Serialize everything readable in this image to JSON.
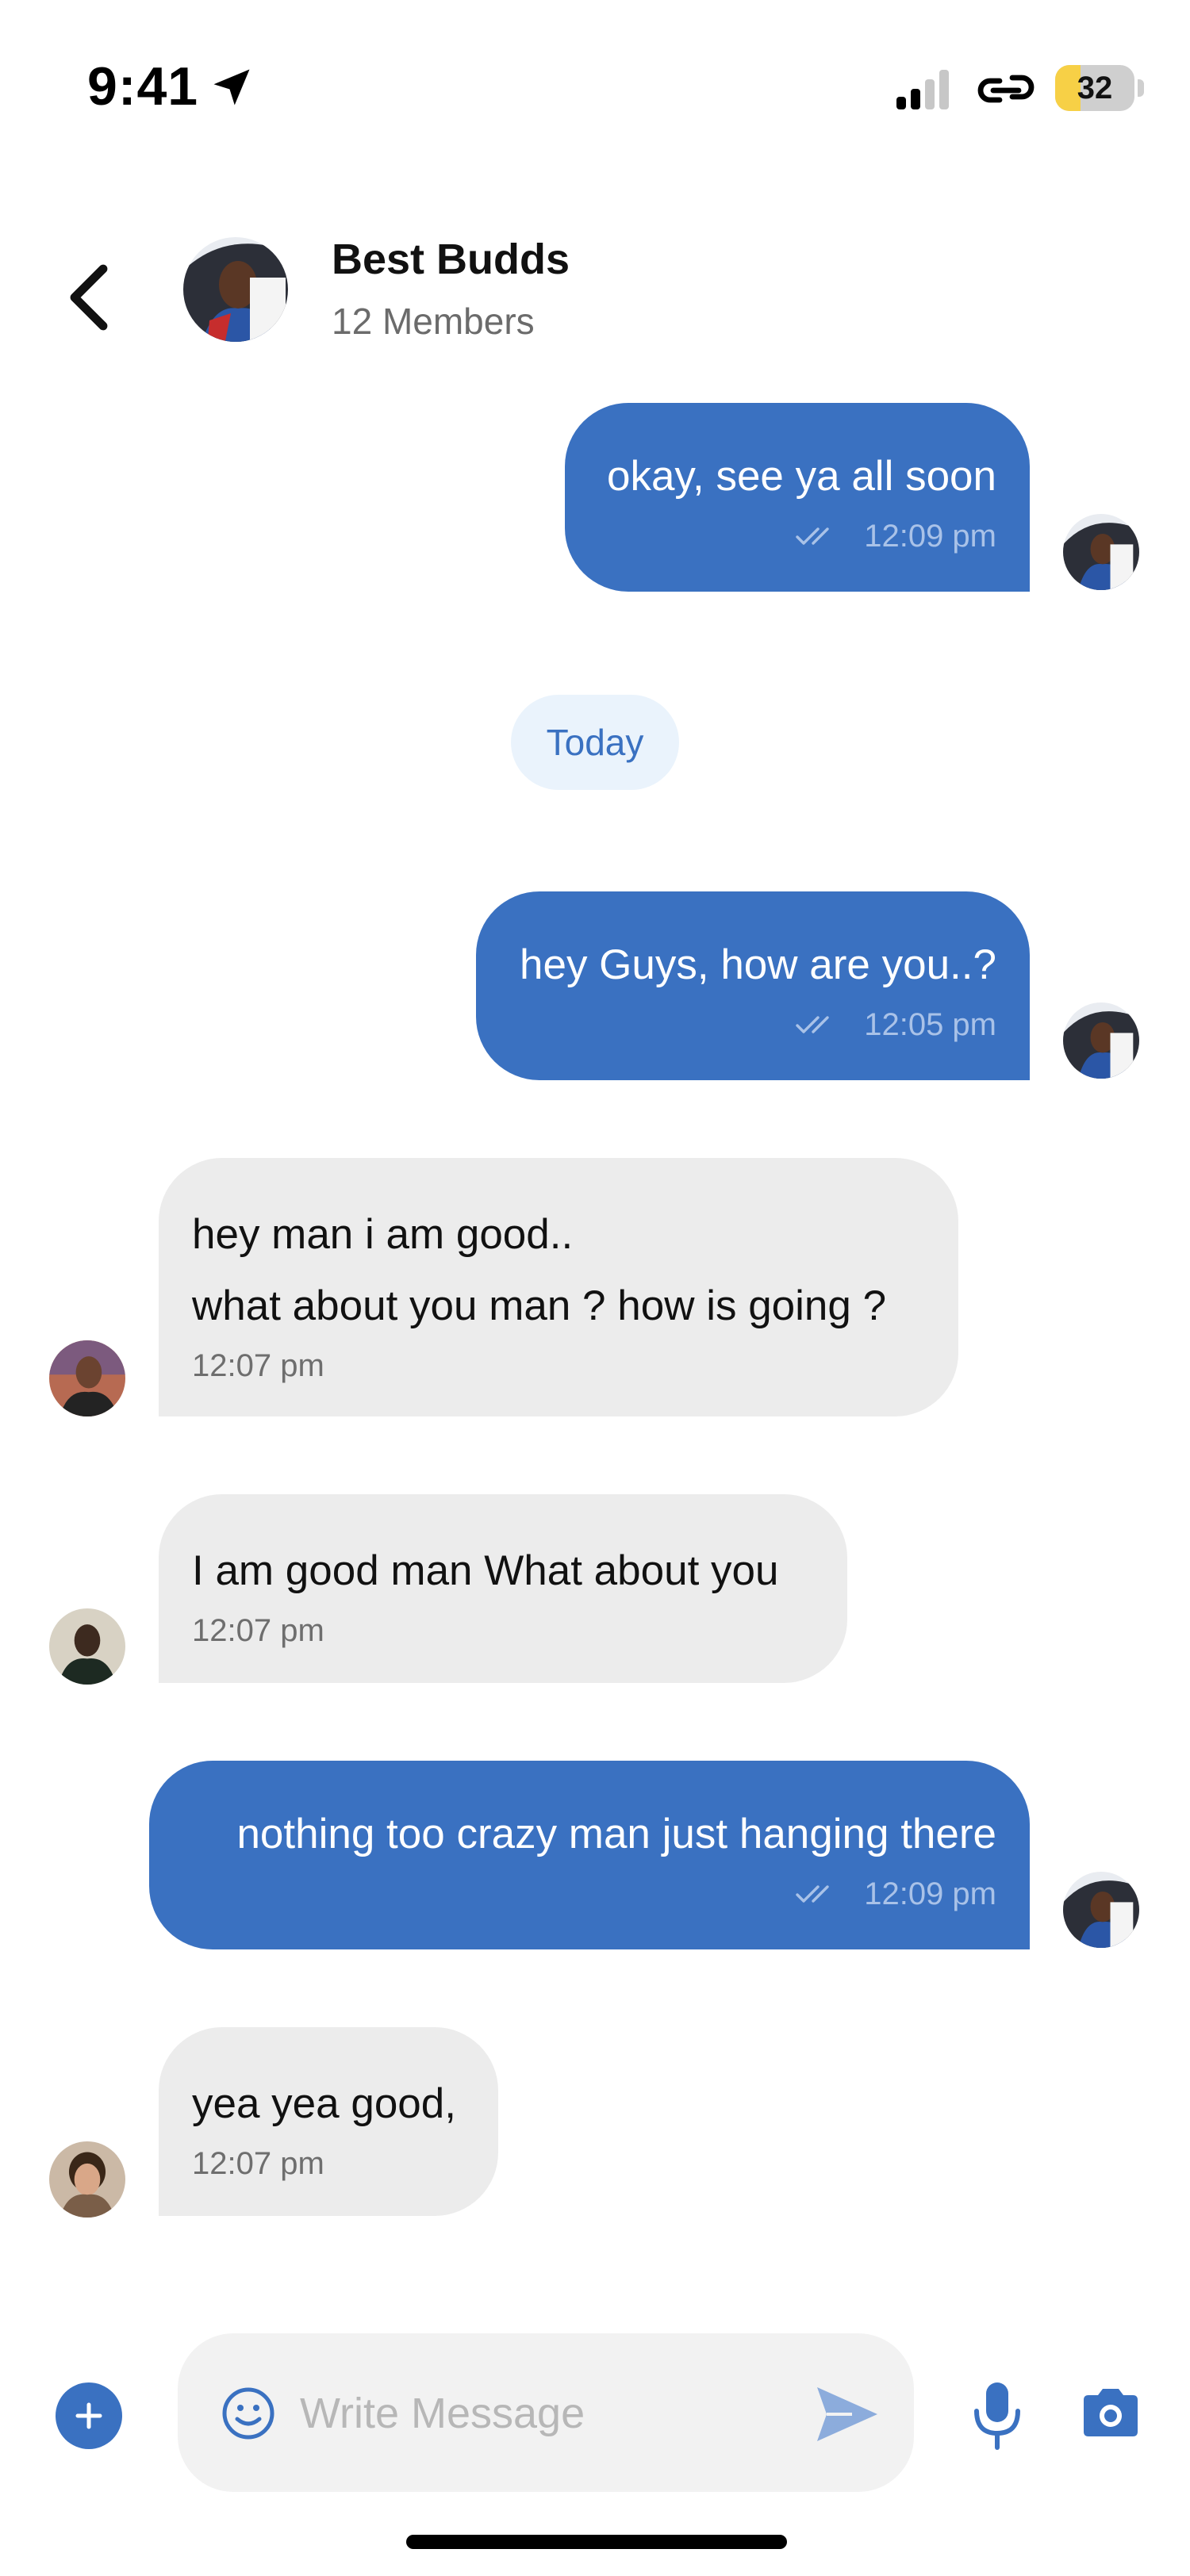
{
  "status_bar": {
    "time": "9:41",
    "battery_level": "32",
    "battery_fraction": 0.32
  },
  "header": {
    "back_icon": "chevron-left-icon",
    "title": "Best Budds",
    "subtitle": "12 Members"
  },
  "messages": [
    {
      "direction": "outgoing",
      "lines": [
        "okay, see ya all soon"
      ],
      "time": "12:09 pm",
      "read_icon": "double-check-icon"
    },
    {
      "direction": "outgoing",
      "lines": [
        "hey Guys, how are you..?"
      ],
      "time": "12:05 pm",
      "read_icon": "double-check-icon"
    },
    {
      "direction": "incoming",
      "lines": [
        "hey man i am good..",
        "what about you man ? how is going ?"
      ],
      "time": "12:07 pm"
    },
    {
      "direction": "incoming",
      "lines": [
        "I am good man What about you"
      ],
      "time": "12:07 pm"
    },
    {
      "direction": "outgoing",
      "lines": [
        "nothing too crazy man just hanging there"
      ],
      "time": "12:09 pm",
      "read_icon": "double-check-icon"
    },
    {
      "direction": "incoming",
      "lines": [
        "yea yea good,"
      ],
      "time": "12:07 pm"
    }
  ],
  "date_divider": "Today",
  "composer": {
    "placeholder": "Write Message",
    "value": "",
    "icons": [
      "plus-icon",
      "emoji-icon",
      "send-icon",
      "microphone-icon",
      "camera-icon"
    ]
  },
  "colors": {
    "accent": "#3a71c1",
    "outgoing_bubble": "#3a71c1",
    "incoming_bubble": "#ececec",
    "date_chip_bg": "#eaf3fc",
    "battery_fill": "#f7d046"
  }
}
